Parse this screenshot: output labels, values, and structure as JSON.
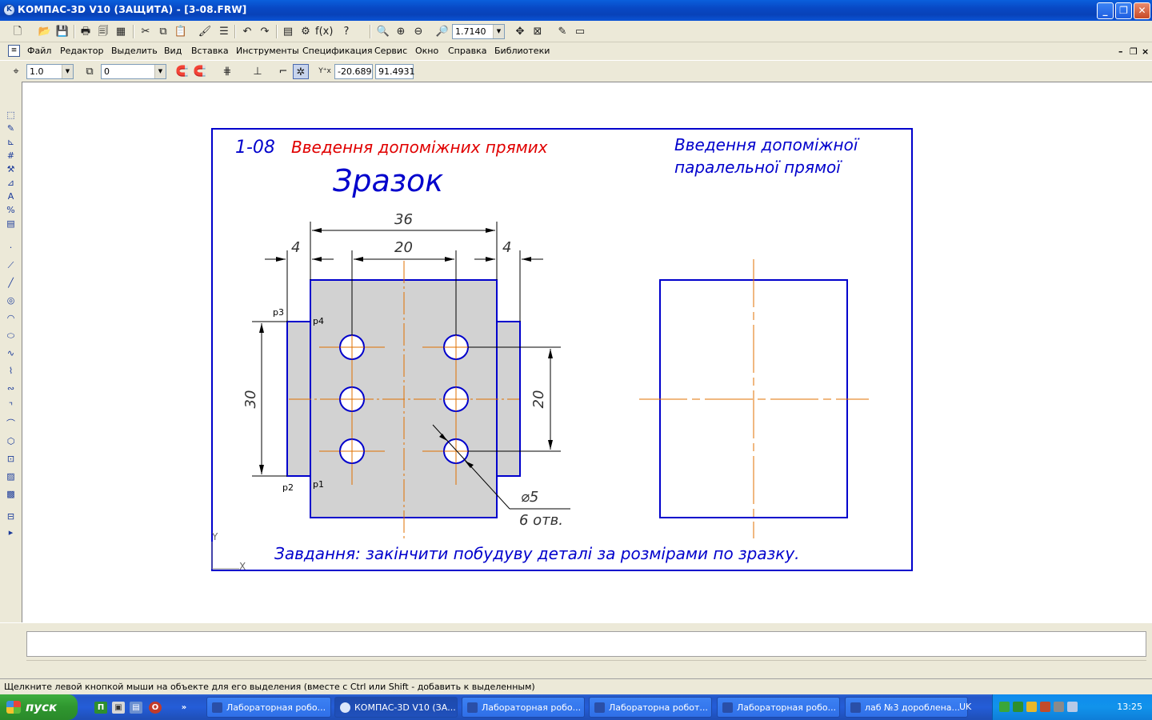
{
  "window": {
    "title": "КОМПАС-3D V10 (ЗАЩИТА) - [3-08.FRW]",
    "minimize": "_",
    "maximize": "❐",
    "close": "✕"
  },
  "toolbar": {
    "zoom_value": "1.7140"
  },
  "menu": {
    "items": [
      "Файл",
      "Редактор",
      "Выделить",
      "Вид",
      "Вставка",
      "Инструменты",
      "Спецификация",
      "Сервис",
      "Окно",
      "Справка",
      "Библиотеки"
    ]
  },
  "toolbar2": {
    "step_value": "1.0",
    "layer_value": "0",
    "coord_x": "-20.689",
    "coord_y": "91.4931"
  },
  "drawing": {
    "heading_number": "1-08",
    "heading_text": "Введення допоміжних прямих",
    "sample_label": "Зразок",
    "right_title_line1": "Введення допоміжної",
    "right_title_line2": "паралельної прямої",
    "task_text": "Завдання: закінчити побудуву деталі за розмірами по зразку.",
    "dim_36": "36",
    "dim_20_top": "20",
    "dim_4_left": "4",
    "dim_4_right": "4",
    "dim_30": "30",
    "dim_20_right": "20",
    "dim_diameter": "⌀5",
    "dim_holes": "6 отв.",
    "point_p1": "р1",
    "point_p2": "р2",
    "point_p3": "р3",
    "point_p4": "р4",
    "axis_x": "X",
    "axis_y": "Y"
  },
  "colors": {
    "frame": "#0000cc",
    "heading_red": "#e00000",
    "axis_orange": "#e07000",
    "fill_grey": "#d2d2d2"
  },
  "statusbar": {
    "hint": "Щелкните левой кнопкой мыши на объекте для его выделения (вместе с Ctrl или Shift - добавить к выделенным)"
  },
  "taskbar": {
    "start_label": "пуск",
    "tasks": [
      "Лабораторная робо...",
      "КОМПАС-3D V10 (ЗА...",
      "Лабораторная робо...",
      "Лабораторна робот...",
      "Лабораторная робо...",
      "лаб №3 доробленa..."
    ],
    "language": "UK",
    "clock": "13:25"
  }
}
